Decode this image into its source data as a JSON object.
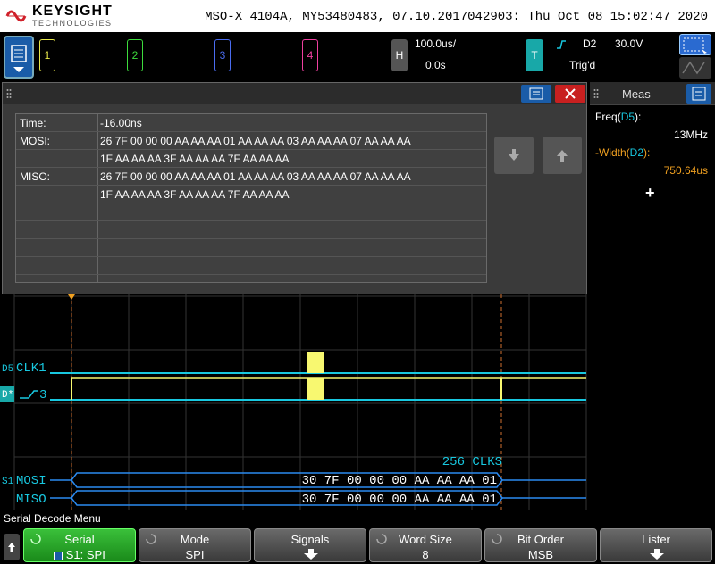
{
  "header": {
    "brand": "KEYSIGHT",
    "brand_sub": "TECHNOLOGIES",
    "status": "MSO-X 4104A, MY53480483, 07.10.2017042903: Thu Oct 08 15:02:47 2020"
  },
  "channels": [
    {
      "label": "1",
      "color": "#e8e84a"
    },
    {
      "label": "2",
      "color": "#3ddc3d"
    },
    {
      "label": "3",
      "color": "#4a6cf0"
    },
    {
      "label": "4",
      "color": "#f040a0"
    }
  ],
  "horizontal": {
    "key": "H",
    "scale": "100.0us/",
    "delay": "0.0s"
  },
  "trigger": {
    "key": "T",
    "source": "D2",
    "level": "30.0V",
    "status": "Trig'd",
    "slope_icon": "rising-edge-icon"
  },
  "lister": {
    "rows": [
      {
        "label": "Time:",
        "value": "-16.00ns"
      },
      {
        "label": "MOSI:",
        "value": "26 7F 00 00 00 AA AA AA 01 AA AA AA 03 AA AA AA 07 AA AA AA"
      },
      {
        "label": "",
        "value": "1F AA AA AA 3F AA AA AA 7F AA AA AA"
      },
      {
        "label": "MISO:",
        "value": "26 7F 00 00 00 AA AA AA 01 AA AA AA 03 AA AA AA 07 AA AA AA"
      },
      {
        "label": "",
        "value": "1F AA AA AA 3F AA AA AA 7F AA AA AA"
      },
      {
        "label": "",
        "value": ""
      },
      {
        "label": "",
        "value": ""
      },
      {
        "label": "",
        "value": ""
      },
      {
        "label": "",
        "value": ""
      }
    ]
  },
  "meas": {
    "title": "Meas",
    "items": [
      {
        "name": "Freq",
        "source": "D5",
        "value": "13MHz",
        "color": "#fff"
      },
      {
        "name": "-Width",
        "source": "D2",
        "value": "750.64us",
        "color": "#f0a020"
      }
    ],
    "add_label": "+"
  },
  "traces": {
    "clk_label": "CLK1",
    "clk_prefix": "D5",
    "bus_label": "3",
    "bus_prefix": "D*",
    "clks_text": "256 CLKS",
    "serial_prefix": "S1",
    "mosi_label": "MOSI",
    "miso_label": "MISO",
    "mosi_bytes": "30 7F 00 00 00 AA AA AA 01",
    "miso_bytes": "30 7F 00 00 00 AA AA AA 01",
    "trace_color": "#18c8e0",
    "digital_color": "#f8f870"
  },
  "menu_title": "Serial Decode Menu",
  "softkeys": [
    {
      "top": "Serial",
      "bottom": "S1: SPI"
    },
    {
      "top": "Mode",
      "bottom": "SPI"
    },
    {
      "top": "Signals",
      "bottom": ""
    },
    {
      "top": "Word Size",
      "bottom": "8"
    },
    {
      "top": "Bit Order",
      "bottom": "MSB"
    },
    {
      "top": "Lister",
      "bottom": ""
    }
  ]
}
